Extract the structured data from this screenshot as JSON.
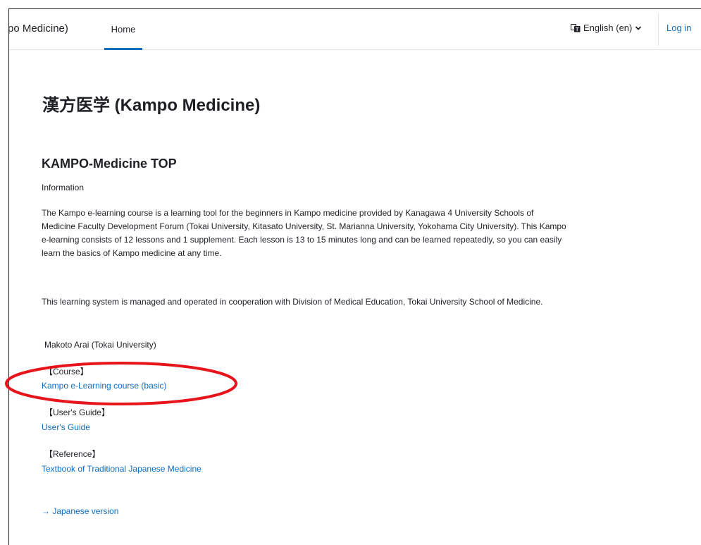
{
  "navbar": {
    "site_name": "po Medicine)",
    "home_label": "Home",
    "language_label": "English (en)",
    "login_label": "Log in"
  },
  "main": {
    "page_title": "漢方医学 (Kampo Medicine)",
    "section_title": "KAMPO-Medicine TOP",
    "info_label": "Information",
    "paragraph1": "The Kampo e-learning course is a learning tool for the beginners in Kampo medicine provided by Kanagawa 4 University Schools of Medicine Faculty Development Forum (Tokai University, Kitasato University, St. Marianna University, Yokohama City University). This Kampo e-learning consists of 12 lessons and 1 supplement. Each lesson is 13 to 15 minutes long and can be learned repeatedly, so you can easily learn the basics of Kampo medicine at any time.",
    "paragraph2": "This learning system is managed and operated in cooperation with Division of Medical Education, Tokai University School of Medicine.",
    "author": "Makoto Arai (Tokai University)",
    "course_label": "【Course】",
    "course_link": "Kampo e-Learning course (basic)",
    "guide_label": "【User's Guide】",
    "guide_link": "User's Guide",
    "reference_label": "【Reference】",
    "reference_link": "Textbook of Traditional Japanese Medicine",
    "japanese_link": "→ Japanese version"
  },
  "colors": {
    "link": "#0f6cbf",
    "text": "#1d2125",
    "annotation": "#e8141c"
  },
  "icons": {
    "language": "language-icon",
    "dropdown": "chevron-down-icon"
  }
}
